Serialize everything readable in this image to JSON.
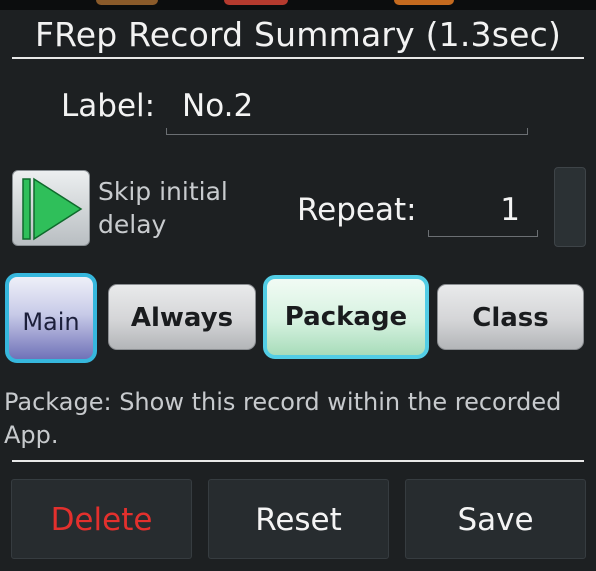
{
  "colors": {
    "background": "#1d2022",
    "delete_text": "#e3302d",
    "selected_tab_border": "#52cde5",
    "play_icon": "#2fbf5a"
  },
  "dialog": {
    "title": "FRep Record Summary (1.3sec)"
  },
  "label": {
    "caption": "Label:",
    "value": "No.2"
  },
  "play": {
    "icon": "play-icon",
    "skip_text": "Skip initial delay"
  },
  "repeat": {
    "caption": "Repeat:",
    "value": "1"
  },
  "tabs": [
    {
      "label": "Main",
      "selected": true
    },
    {
      "label": "Always",
      "selected": false
    },
    {
      "label": "Package",
      "selected": true
    },
    {
      "label": "Class",
      "selected": false
    }
  ],
  "description": "Package: Show this record within the recorded App.",
  "actions": {
    "delete": "Delete",
    "reset": "Reset",
    "save": "Save"
  }
}
